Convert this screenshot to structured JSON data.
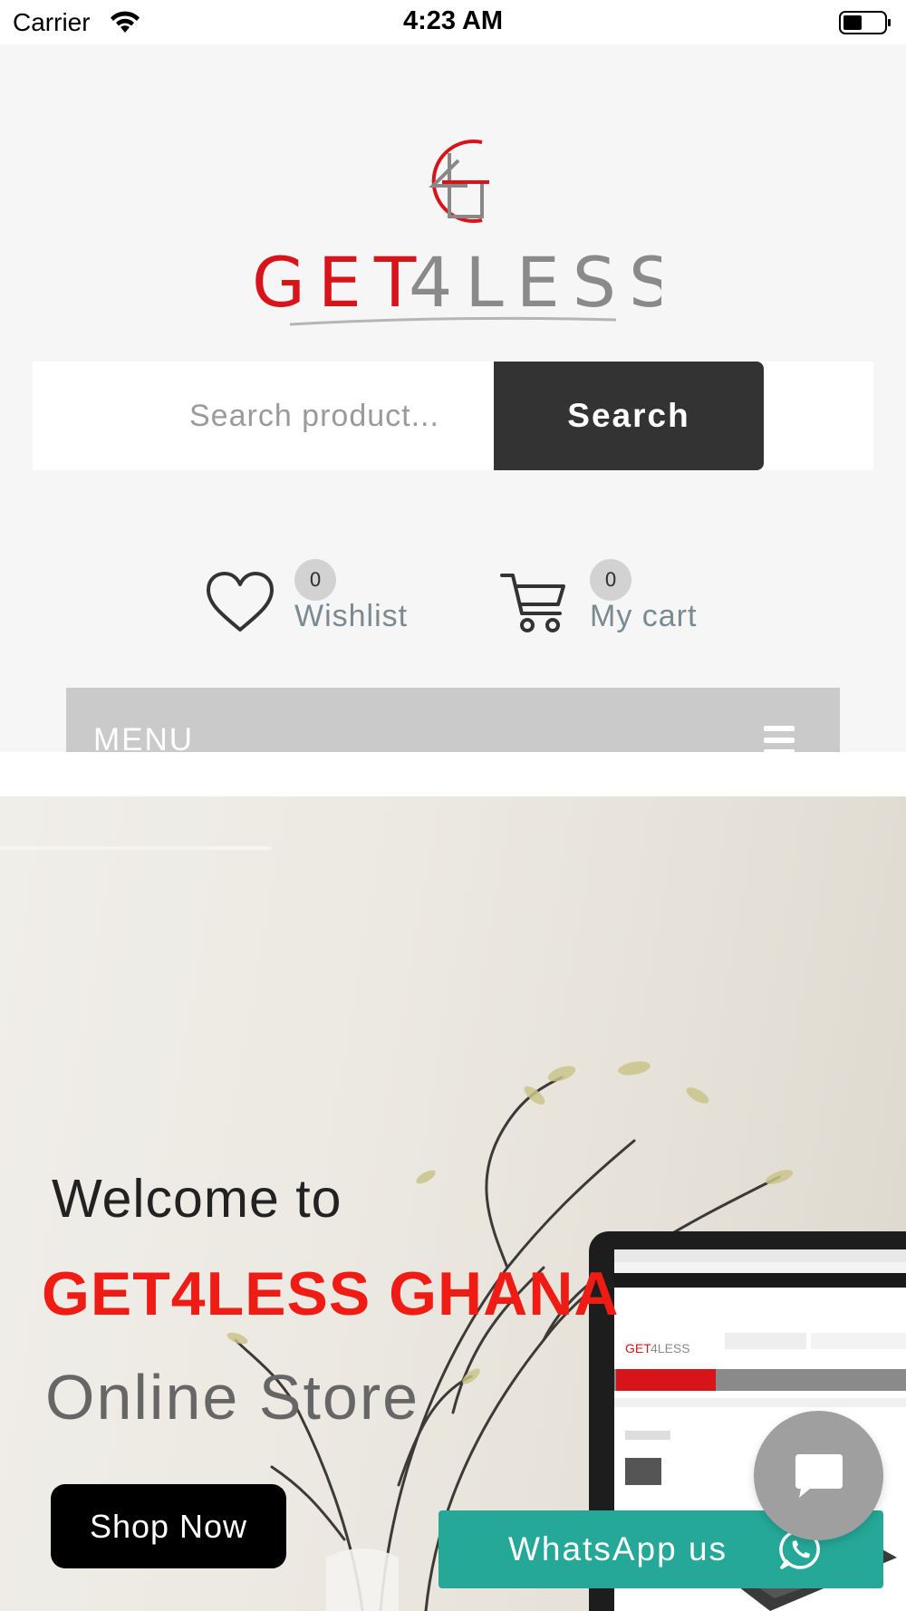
{
  "status_bar": {
    "carrier": "Carrier",
    "time": "4:23 AM"
  },
  "brand": {
    "logo_text_red": "GET",
    "logo_text_grey": "4LESS",
    "accent": "#ee1c14",
    "grey": "#8a8a8a"
  },
  "search": {
    "placeholder": "Search product...",
    "button_label": "Search"
  },
  "header_links": {
    "wishlist": {
      "count": "0",
      "label": "Wishlist"
    },
    "cart": {
      "count": "0",
      "label": "My cart"
    }
  },
  "menu": {
    "label": "MENU"
  },
  "hero": {
    "welcome": "Welcome to",
    "brand": "GET4LESS GHANA",
    "subtitle": "Online Store",
    "cta": "Shop Now"
  },
  "floating": {
    "whatsapp_label": "WhatsApp us",
    "whatsapp_color": "#25a898",
    "chat_color": "#9f9f9f"
  }
}
